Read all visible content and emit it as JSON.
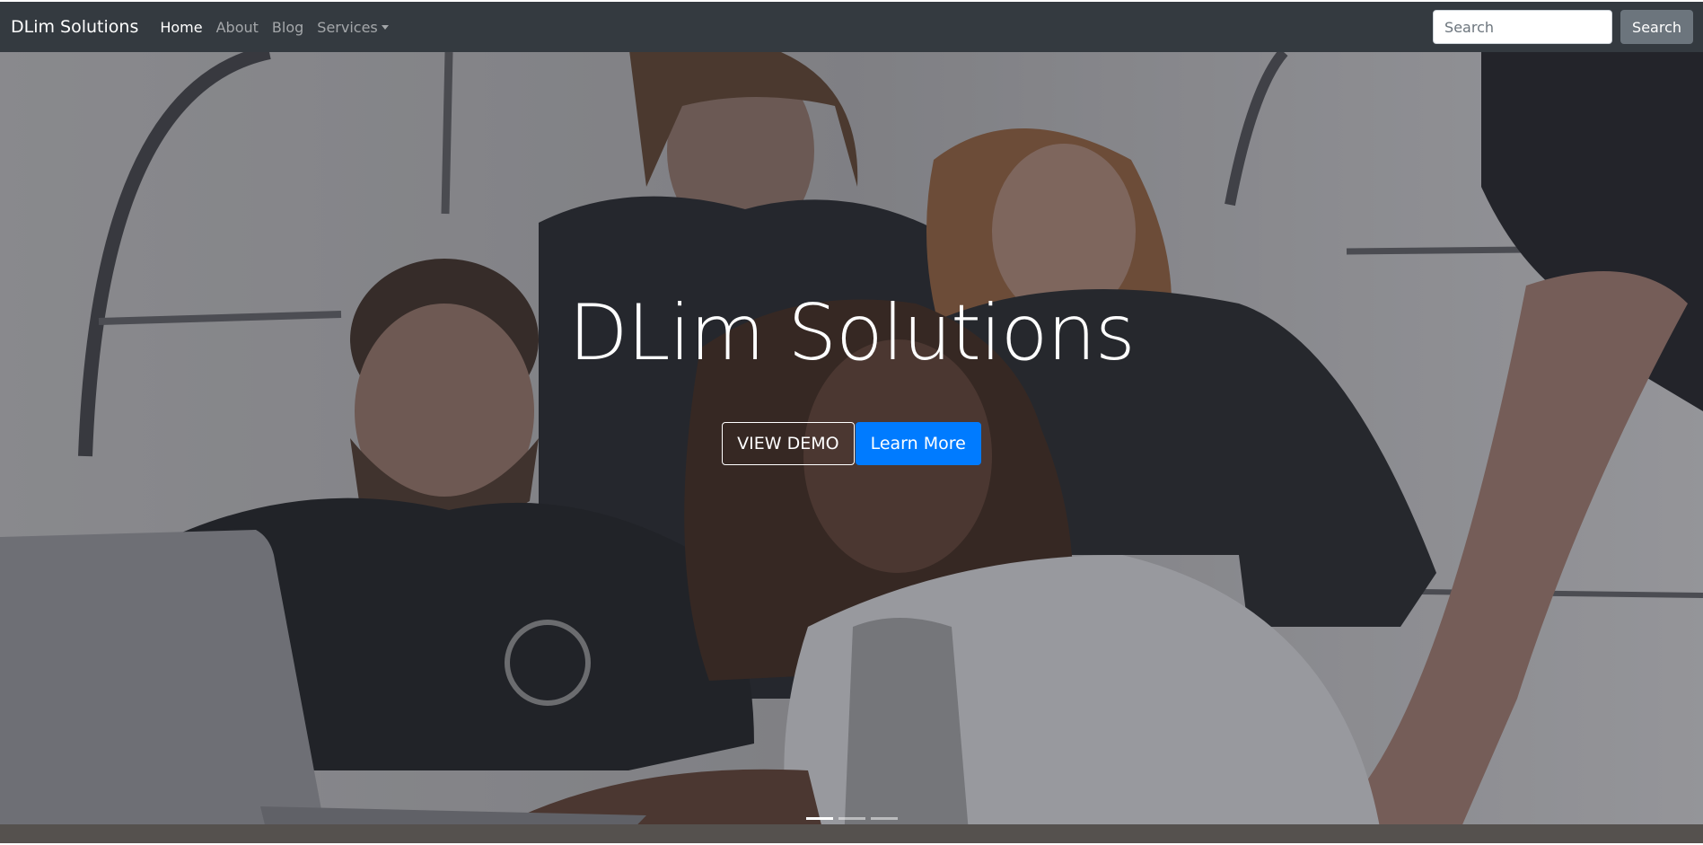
{
  "navbar": {
    "brand": "DLim Solutions",
    "items": [
      {
        "label": "Home",
        "active": true
      },
      {
        "label": "About",
        "active": false
      },
      {
        "label": "Blog",
        "active": false
      },
      {
        "label": "Services",
        "active": false,
        "dropdown": true
      }
    ],
    "search": {
      "placeholder": "Search",
      "value": "",
      "button_label": "Search"
    }
  },
  "hero": {
    "title": "DLim Solutions",
    "primary_outline_button": "VIEW DEMO",
    "primary_button": "Learn More",
    "carousel_indicators": 3,
    "active_indicator": 0
  },
  "colors": {
    "navbar_bg": "#343a40",
    "primary": "#007bff",
    "secondary": "#6c757d",
    "text_light": "#ffffff"
  }
}
